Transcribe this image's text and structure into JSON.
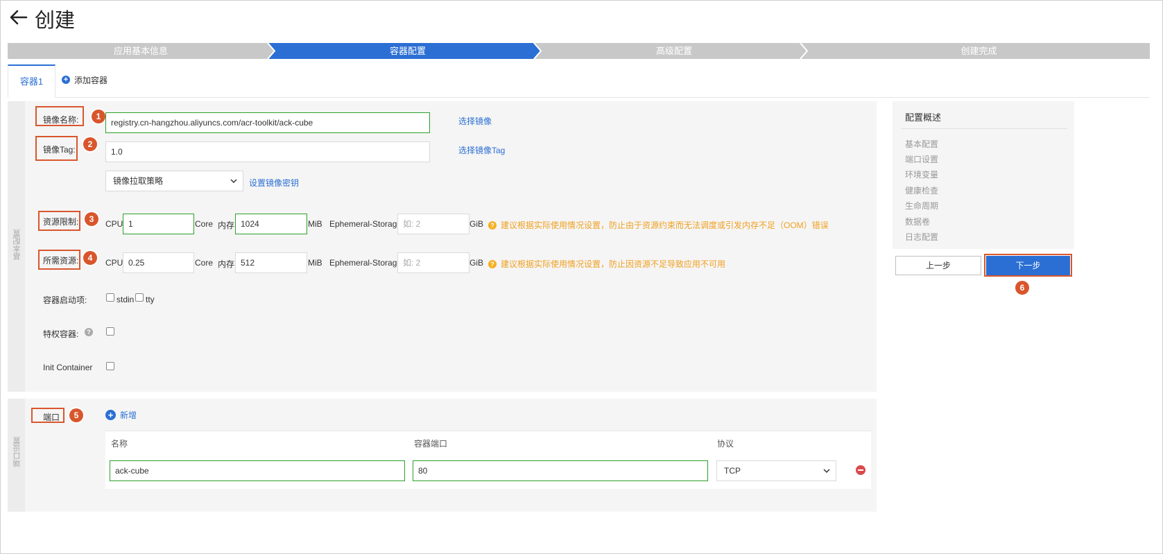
{
  "header": {
    "title": "创建"
  },
  "steps": [
    {
      "label": "应用基本信息",
      "state": "done"
    },
    {
      "label": "容器配置",
      "state": "active"
    },
    {
      "label": "高级配置",
      "state": "todo"
    },
    {
      "label": "创建完成",
      "state": "todo"
    }
  ],
  "tabs": {
    "active": "容器1",
    "add": "添加容器"
  },
  "basic": {
    "side_label": "基本配置",
    "image_name": {
      "label": "镜像名称:",
      "value": "registry.cn-hangzhou.aliyuncs.com/acr-toolkit/ack-cube",
      "link": "选择镜像"
    },
    "image_tag": {
      "label": "镜像Tag:",
      "value": "1.0",
      "link": "选择镜像Tag"
    },
    "pull_policy": {
      "value": "镜像拉取策略",
      "link": "设置镜像密钥"
    },
    "limits": {
      "label": "资源限制:",
      "cpu_label": "CPU",
      "cpu_value": "1",
      "cpu_unit": "Core",
      "mem_label": "内存",
      "mem_value": "1024",
      "mem_unit": "MiB",
      "storage_label": "Ephemeral-Storage",
      "storage_placeholder": "如: 2",
      "storage_unit": "GiB",
      "hint": "建议根据实际使用情况设置，防止由于资源约束而无法调度或引发内存不足（OOM）错误"
    },
    "requests": {
      "label": "所需资源:",
      "cpu_label": "CPU",
      "cpu_value": "0.25",
      "cpu_unit": "Core",
      "mem_label": "内存",
      "mem_value": "512",
      "mem_unit": "MiB",
      "storage_label": "Ephemeral-Storage",
      "storage_placeholder": "如: 2",
      "storage_unit": "GiB",
      "hint": "建议根据实际使用情况设置，防止因资源不足导致应用不可用"
    },
    "startup": {
      "label": "容器启动项:",
      "stdin": "stdin",
      "tty": "tty"
    },
    "privileged": {
      "label": "特权容器:"
    },
    "init": {
      "label": "Init Container"
    }
  },
  "ports": {
    "side_label": "端口设置",
    "label": "端口",
    "add": "新增",
    "headers": [
      "名称",
      "容器端口",
      "协议"
    ],
    "rows": [
      {
        "name": "ack-cube",
        "port": "80",
        "protocol": "TCP"
      }
    ]
  },
  "summary": {
    "title": "配置概述",
    "items": [
      "基本配置",
      "端口设置",
      "环境变量",
      "健康检查",
      "生命周期",
      "数据卷",
      "日志配置"
    ]
  },
  "actions": {
    "prev": "上一步",
    "next": "下一步"
  },
  "callouts": [
    "1",
    "2",
    "3",
    "4",
    "5",
    "6"
  ],
  "colors": {
    "primary": "#2b6fd4",
    "callout": "#d9562c",
    "warning": "#f0a020",
    "valid_border": "#2aa02a"
  }
}
